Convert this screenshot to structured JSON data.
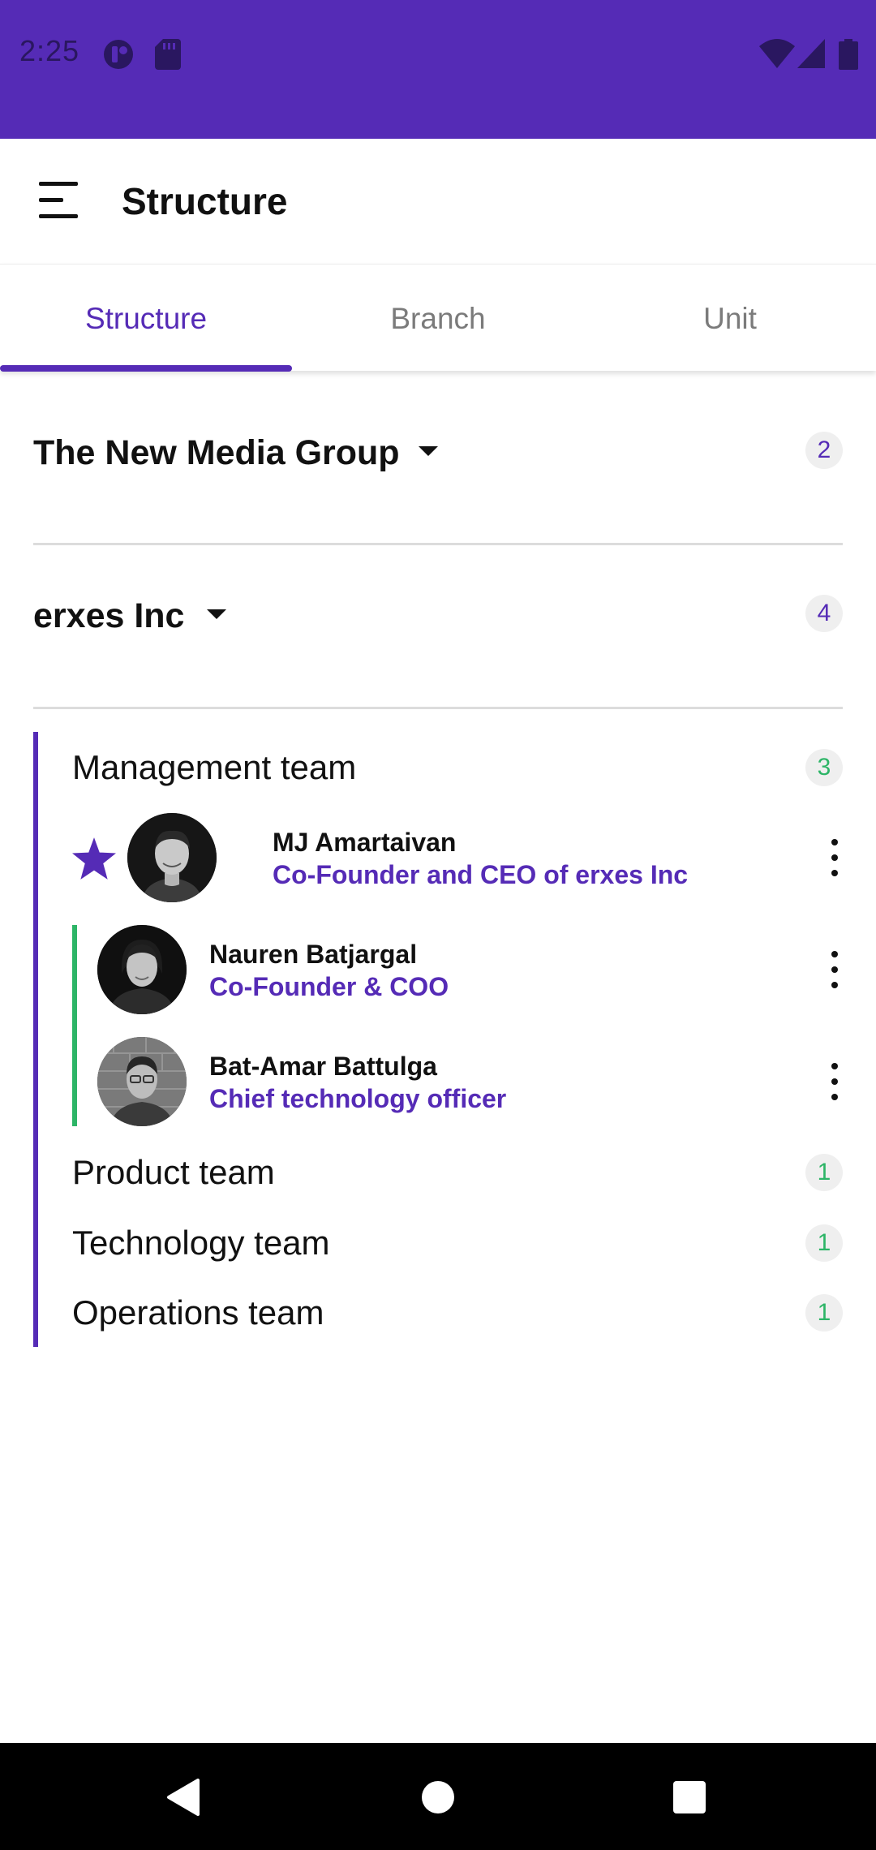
{
  "status_bar": {
    "time": "2:25",
    "icons": [
      "app-indicator-icon",
      "sd-card-icon",
      "wifi-icon",
      "signal-icon",
      "battery-icon"
    ],
    "color": "#552bb6"
  },
  "app_bar": {
    "title": "Structure",
    "menu_icon": "hamburger-menu-icon"
  },
  "tabs": [
    {
      "label": "Structure",
      "active": true
    },
    {
      "label": "Branch",
      "active": false
    },
    {
      "label": "Unit",
      "active": false
    }
  ],
  "groups": [
    {
      "name": "The New Media Group",
      "count": "2"
    },
    {
      "name": "erxes Inc",
      "count": "4"
    }
  ],
  "teams": {
    "management": {
      "name": "Management  team",
      "count": "3",
      "leader": {
        "name": "MJ Amartaivan",
        "role": "Co-Founder and CEO of erxes Inc",
        "starred": true
      },
      "members": [
        {
          "name": "Nauren Batjargal",
          "role": "Co-Founder & COO"
        },
        {
          "name": "Bat-Amar Battulga",
          "role": "Chief technology officer"
        }
      ]
    },
    "product": {
      "name": "Product team",
      "count": "1"
    },
    "technology": {
      "name": "Technology team",
      "count": "1"
    },
    "operations": {
      "name": "Operations team",
      "count": "1"
    }
  },
  "nav_bar": {
    "icons": [
      "back-icon",
      "home-icon",
      "recents-icon"
    ]
  },
  "colors": {
    "accent": "#552bb6",
    "green": "#2db567"
  }
}
